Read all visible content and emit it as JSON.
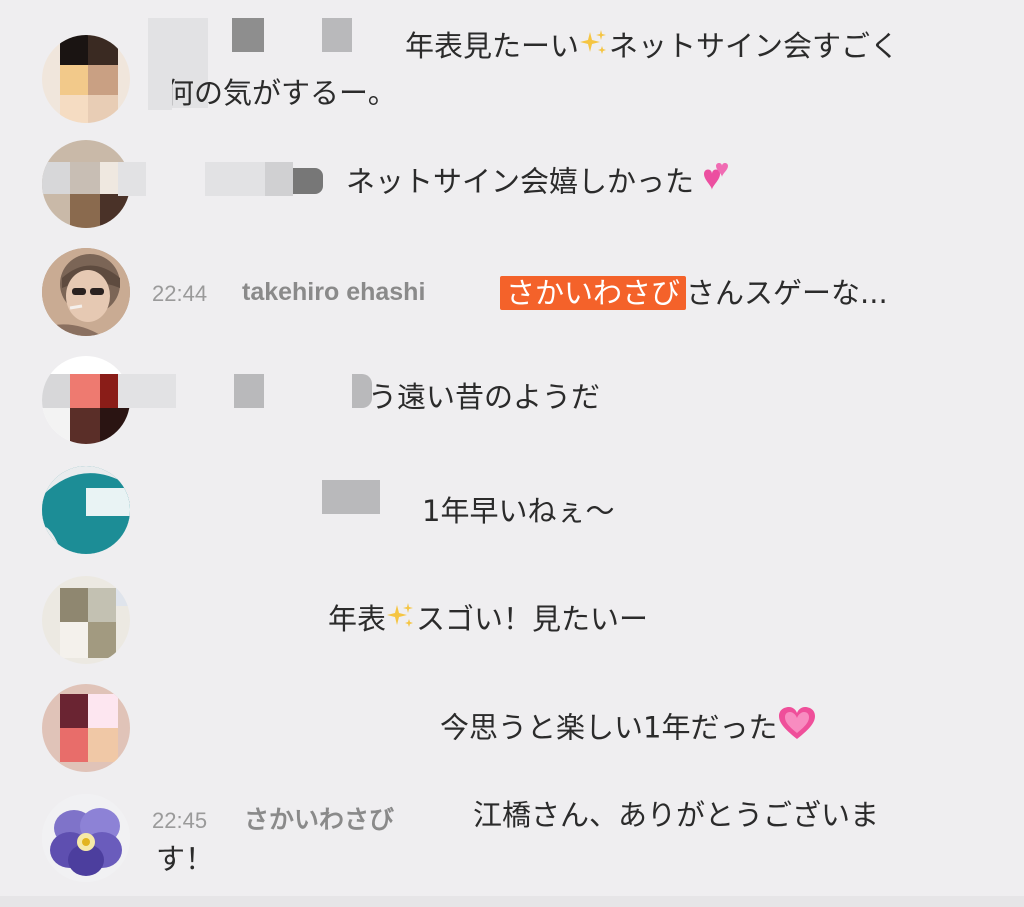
{
  "messages": [
    {
      "id": "m1",
      "time": "",
      "name": "",
      "text_line1_a": "年表見たーい",
      "text_line1_b": "ネットサイン会すごく",
      "text_line2": "何の気がするー。",
      "icon": "sparkles-icon"
    },
    {
      "id": "m2",
      "time": "",
      "name": "",
      "text": "ネットサイン会嬉しかった",
      "icon": "two-hearts-icon"
    },
    {
      "id": "m3",
      "time": "22:44",
      "name": "takehiro ehashi",
      "mention": "さかいわさび",
      "text": "さんスゲーな..."
    },
    {
      "id": "m4",
      "time": "",
      "name": "",
      "text": "う遠い昔のようだ"
    },
    {
      "id": "m5",
      "time": "",
      "name": "",
      "text": "1年早いねぇ～"
    },
    {
      "id": "m6",
      "time": "",
      "name": "",
      "text_a": "年表",
      "text_b": "スゴい！見たいー",
      "icon": "sparkles-icon"
    },
    {
      "id": "m7",
      "time": "",
      "name": "",
      "text": "今思うと楽しい1年だった",
      "icon": "pink-heart-icon"
    },
    {
      "id": "m8",
      "time": "22:45",
      "name": "さかいわさび",
      "text_line1": "江橋さん、ありがとうございま",
      "text_line2": "す！"
    }
  ],
  "colors": {
    "background": "#efeef0",
    "mention_bg": "#f4622a",
    "name": "#8a8a8a",
    "time": "#9a9a9a"
  }
}
